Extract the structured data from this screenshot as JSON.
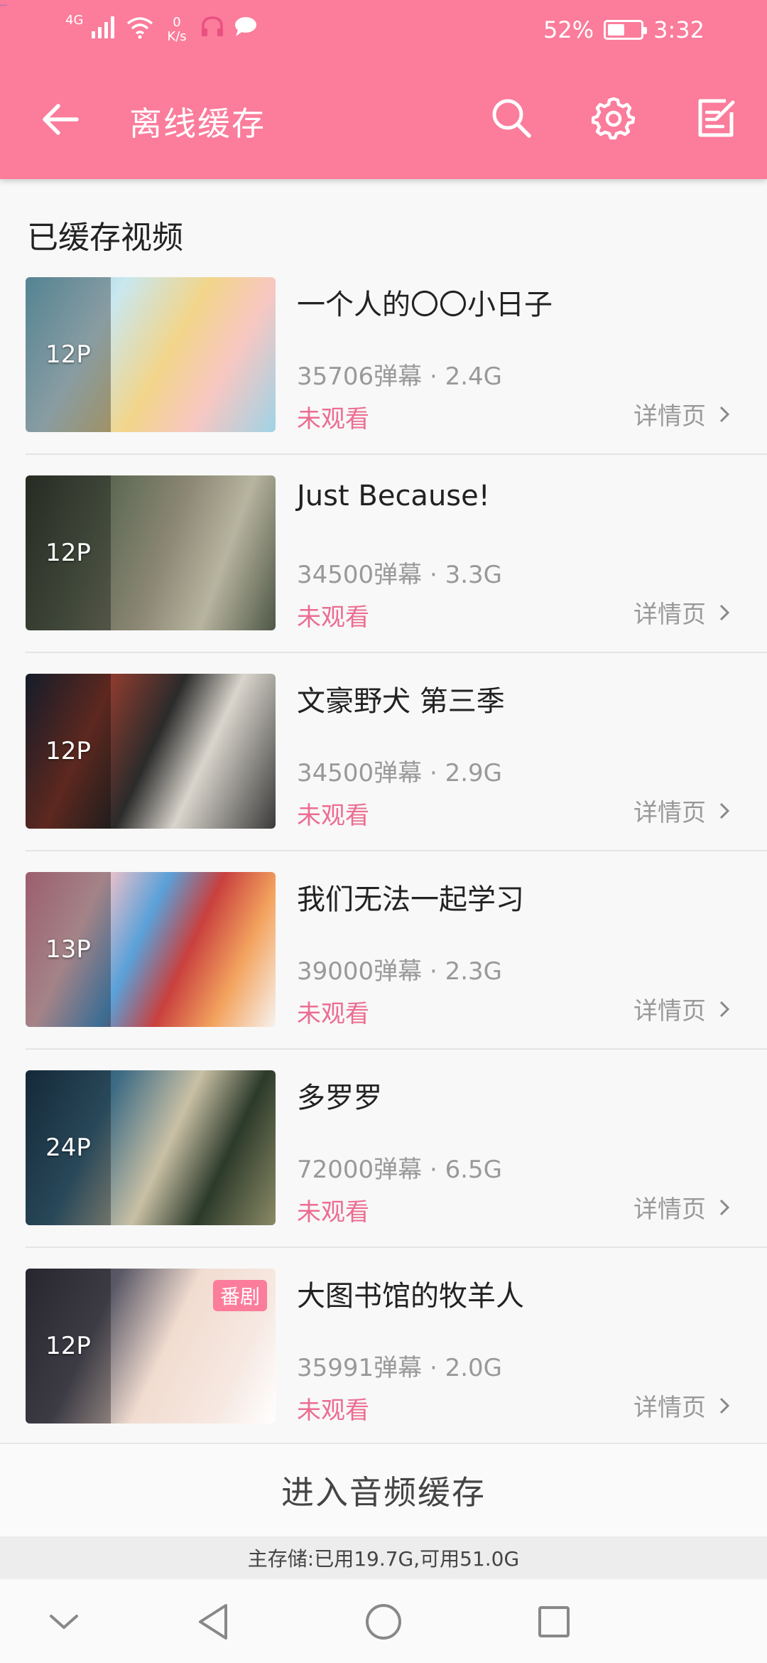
{
  "status_bar": {
    "corner_text": "…",
    "network_label": "4G",
    "net_speed_value": "0",
    "net_speed_unit": "K/s",
    "battery_percent": "52%",
    "battery_level": 0.52,
    "time": "3:32"
  },
  "toolbar": {
    "title": "离线缓存",
    "icons": [
      "back-arrow-icon",
      "search-icon",
      "gear-icon",
      "edit-icon"
    ]
  },
  "section": {
    "title": "已缓存视频"
  },
  "videos": [
    {
      "title": "一个人的〇〇小日子",
      "parts": "12P",
      "meta": "35706弹幕 · 2.4G",
      "status": "未观看",
      "detail": "详情页",
      "badge": ""
    },
    {
      "title": "Just Because!",
      "parts": "12P",
      "meta": "34500弹幕 · 3.3G",
      "status": "未观看",
      "detail": "详情页",
      "badge": ""
    },
    {
      "title": "文豪野犬 第三季",
      "parts": "12P",
      "meta": "34500弹幕 · 2.9G",
      "status": "未观看",
      "detail": "详情页",
      "badge": ""
    },
    {
      "title": "我们无法一起学习",
      "parts": "13P",
      "meta": "39000弹幕 · 2.3G",
      "status": "未观看",
      "detail": "详情页",
      "badge": ""
    },
    {
      "title": "多罗罗",
      "parts": "24P",
      "meta": "72000弹幕 · 6.5G",
      "status": "未观看",
      "detail": "详情页",
      "badge": ""
    },
    {
      "title": "大图书馆的牧羊人",
      "parts": "12P",
      "meta": "35991弹幕 · 2.0G",
      "status": "未观看",
      "detail": "详情页",
      "badge": "番剧"
    }
  ],
  "audio_cache": {
    "label": "进入音频缓存"
  },
  "storage": {
    "text": "主存储:已用19.7G,可用51.0G"
  },
  "colors": {
    "accent": "#fb7c9b",
    "status_pink": "#ec6d92"
  }
}
